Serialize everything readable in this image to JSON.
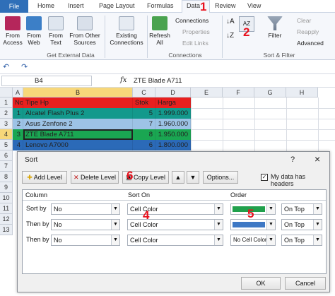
{
  "ribbon_tabs": [
    "File",
    "Home",
    "Insert",
    "Page Layout",
    "Formulas",
    "Data",
    "Review",
    "View"
  ],
  "ribbon": {
    "from_access": "From Access",
    "from_web": "From Web",
    "from_text": "From Text",
    "from_other": "From Other Sources",
    "existing": "Existing Connections",
    "refresh": "Refresh All",
    "connections": "Connections",
    "properties": "Properties",
    "edit_links": "Edit Links",
    "filter": "Filter",
    "clear": "Clear",
    "reapply": "Reapply",
    "advanced": "Advanced",
    "grp_external": "Get External Data",
    "grp_connections": "Connections",
    "grp_sort": "Sort & Filter"
  },
  "name_box": "B4",
  "fx": "fx",
  "formula": "ZTE Blade A711",
  "columns": [
    "A",
    "B",
    "C",
    "D",
    "E",
    "F",
    "G",
    "H"
  ],
  "rows": [
    "1",
    "2",
    "3",
    "4",
    "5",
    "6",
    "7",
    "8",
    "9",
    "10",
    "11",
    "12",
    "13"
  ],
  "table": {
    "header": {
      "no": "No",
      "tipe": "Tipe Hp",
      "stok": "Stok",
      "harga": "Harga"
    },
    "data": [
      {
        "no": "1",
        "tipe": "Alcatel Flash Plus 2",
        "stok": "5",
        "harga": "1.999.000"
      },
      {
        "no": "2",
        "tipe": "Asus Zenfone 2",
        "stok": "7",
        "harga": "1.960.000"
      },
      {
        "no": "3",
        "tipe": "ZTE Blade A711",
        "stok": "8",
        "harga": "1.950.000"
      },
      {
        "no": "4",
        "tipe": "Lenovo A7000",
        "stok": "6",
        "harga": "1.800.000"
      }
    ]
  },
  "sort_dialog": {
    "title": "Sort",
    "help": "?",
    "close": "×",
    "add_level": "Add Level",
    "delete_level": "Delete Level",
    "copy_level": "Copy Level",
    "options": "Options...",
    "has_headers": "My data has headers",
    "col_header": "Column",
    "sorton_header": "Sort On",
    "order_header": "Order",
    "levels": [
      {
        "label": "Sort by",
        "column": "No",
        "sort_on": "Cell Color",
        "order_color": "#20a04c",
        "order_text": "",
        "position": "On Top"
      },
      {
        "label": "Then by",
        "column": "No",
        "sort_on": "Cell Color",
        "order_color": "#3e78c4",
        "order_text": "",
        "position": "On Top"
      },
      {
        "label": "Then by",
        "column": "No",
        "sort_on": "Cell Color",
        "order_color": "",
        "order_text": "No Cell Color",
        "position": "On Top"
      }
    ],
    "ok": "OK",
    "cancel": "Cancel"
  },
  "annotations": [
    "1",
    "2",
    "4",
    "5",
    "6"
  ],
  "colors": {
    "header_row": "#e8201f",
    "row1": "#13998c",
    "row2": "#9dc3e6",
    "row3": "#1aa652",
    "row4": "#2b6ab8",
    "annotation": "#e8101c"
  }
}
